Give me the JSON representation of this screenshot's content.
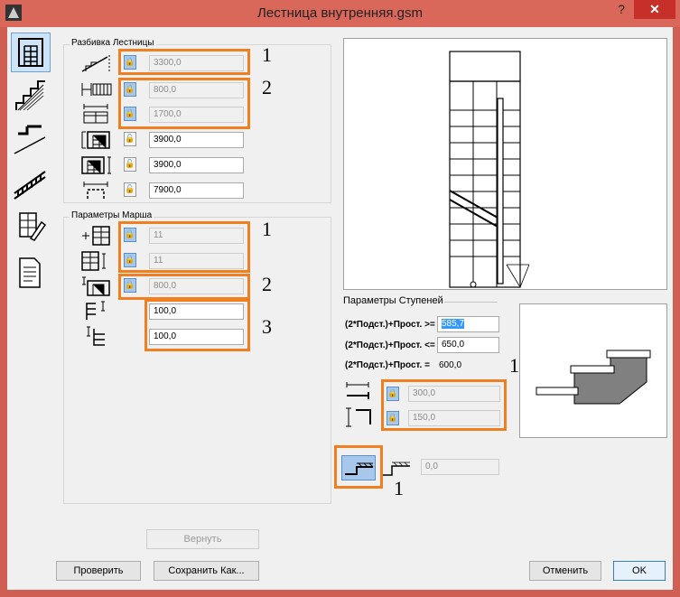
{
  "window": {
    "title": "Лестница внутренняя.gsm",
    "help": "?",
    "close": "✕"
  },
  "groups": {
    "breakdown": "Разбивка Лестницы",
    "flight": "Параметры Марша",
    "steps": "Параметры Ступеней"
  },
  "breakdown_rows": [
    {
      "value": "3300,0",
      "locked": true
    },
    {
      "value": "800,0",
      "locked": true
    },
    {
      "value": "1700,0",
      "locked": true
    },
    {
      "value": "3900,0",
      "locked": false
    },
    {
      "value": "3900,0",
      "locked": false
    },
    {
      "value": "7900,0",
      "locked": false
    }
  ],
  "flight_rows": [
    {
      "value": "11",
      "locked": true
    },
    {
      "value": "11",
      "locked": true
    },
    {
      "value": "800,0",
      "locked": true
    },
    {
      "value": "100,0"
    },
    {
      "value": "100,0"
    }
  ],
  "steps": {
    "rule1_label": "(2*Подст.)+Прост. >=",
    "rule1_value": "585,7",
    "rule2_label": "(2*Подст.)+Прост. <=",
    "rule2_value": "650,0",
    "rule3_label": "(2*Подст.)+Прост. =",
    "rule3_value": "600,0",
    "tread": "300,0",
    "riser": "150,0",
    "nosing": "0,0"
  },
  "annotations": [
    "1",
    "2",
    "1",
    "2",
    "3",
    "1",
    "1"
  ],
  "buttons": {
    "revert": "Вернуть",
    "check": "Проверить",
    "save_as": "Сохранить Как...",
    "cancel": "Отменить",
    "ok": "OK"
  },
  "colors": {
    "accent": "#f07f22",
    "titlebar": "#d9675a",
    "close": "#c7302a"
  }
}
